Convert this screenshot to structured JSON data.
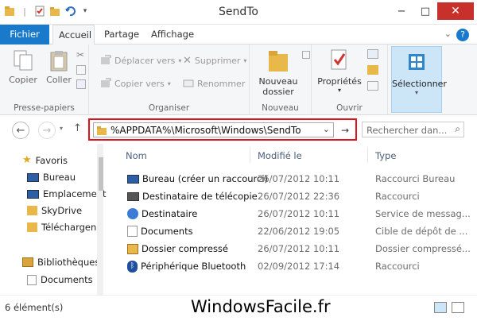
{
  "window": {
    "title": "SendTo"
  },
  "ribbon_tabs": [
    "Fichier",
    "Accueil",
    "Partage",
    "Affichage"
  ],
  "ribbon": {
    "copy": "Copier",
    "paste": "Coller",
    "clipboard_group": "Presse-papiers",
    "move_to": "Déplacer vers",
    "copy_to": "Copier vers",
    "delete": "Supprimer",
    "rename": "Renommer",
    "organize_group": "Organiser",
    "new_folder_line1": "Nouveau",
    "new_folder_line2": "dossier",
    "new_group": "Nouveau",
    "properties": "Propriétés",
    "open_group": "Ouvrir",
    "select": "Sélectionner"
  },
  "address": {
    "path": "%APPDATA%\\Microsoft\\Windows\\SendTo"
  },
  "search": {
    "placeholder": "Rechercher dan..."
  },
  "sidebar": {
    "items": [
      "Favoris",
      "Bureau",
      "Emplacement",
      "SkyDrive",
      "Téléchargen",
      "Bibliothèques",
      "Documents"
    ]
  },
  "columns": {
    "name": "Nom",
    "modified": "Modifié le",
    "type": "Type"
  },
  "files": [
    {
      "name": "Bureau (créer un raccourci)",
      "date": "26/07/2012 10:11",
      "type": "Raccourci Bureau",
      "icon": "desktop-shortcut-icon"
    },
    {
      "name": "Destinataire de télécopie",
      "date": "26/07/2012 22:36",
      "type": "Raccourci",
      "icon": "fax-icon"
    },
    {
      "name": "Destinataire",
      "date": "26/07/2012 10:11",
      "type": "Service de messag...",
      "icon": "mail-recipient-icon"
    },
    {
      "name": "Documents",
      "date": "22/06/2012 19:05",
      "type": "Cible de dépôt de ...",
      "icon": "documents-icon"
    },
    {
      "name": "Dossier compressé",
      "date": "26/07/2012 10:11",
      "type": "Dossier compressé...",
      "icon": "zip-folder-icon"
    },
    {
      "name": "Périphérique Bluetooth",
      "date": "02/09/2012 17:14",
      "type": "Raccourci",
      "icon": "bluetooth-icon"
    }
  ],
  "status": {
    "count": "6 élément(s)"
  },
  "watermark": "WindowsFacile.fr",
  "colors": {
    "file_tab": "#1979ca",
    "highlight_border": "#e0131a",
    "select_bg": "#cde6f7",
    "close_button": "#c7302b"
  }
}
